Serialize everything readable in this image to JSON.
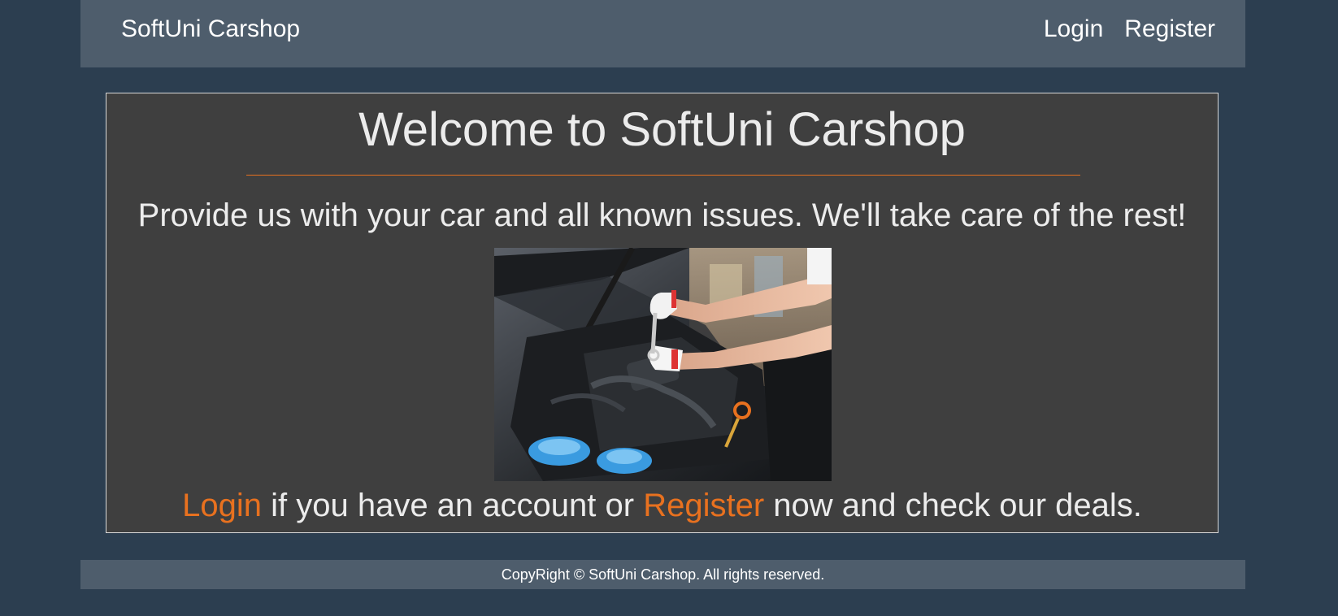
{
  "navbar": {
    "brand": "SoftUni Carshop",
    "links": [
      "Login",
      "Register"
    ]
  },
  "main": {
    "heading": "Welcome to SoftUni Carshop",
    "tagline": "Provide us with your car and all known issues. We'll take care of the rest!",
    "hero_image": "mechanic-engine-photo",
    "cta": {
      "login_link": "Login",
      "middle_text": " if you have an account or ",
      "register_link": "Register",
      "end_text": " now and check our deals."
    },
    "accent_color": "#e8711f"
  },
  "footer": {
    "text": "CopyRight © SoftUni Carshop. All rights reserved."
  }
}
